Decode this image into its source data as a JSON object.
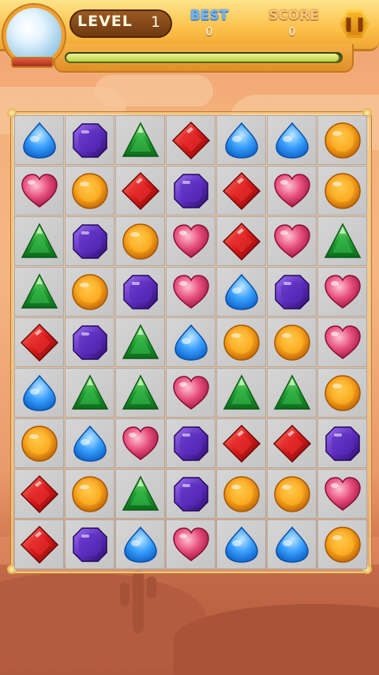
{
  "hud": {
    "level_label": "LEVEL",
    "level_value": "1",
    "best_label": "BEST",
    "best_value": "0",
    "score_label": "SCORE",
    "score_value": "0",
    "progress_fraction": 0.99
  },
  "colors": {
    "blue": "#3aa0ff",
    "purple": "#5a2ab8",
    "green": "#22a034",
    "red": "#d81a1a",
    "pink": "#e8507e",
    "orange": "#f7a21c"
  },
  "board": {
    "rows": [
      [
        "blue-drop-icon",
        "purple-octagon-icon",
        "green-triangle-icon",
        "red-diamond-icon",
        "blue-drop-icon",
        "blue-drop-icon",
        "orange-circle-icon"
      ],
      [
        "pink-heart-icon",
        "orange-circle-icon",
        "red-diamond-icon",
        "purple-octagon-icon",
        "red-diamond-icon",
        "pink-heart-icon",
        "orange-circle-icon"
      ],
      [
        "green-triangle-icon",
        "purple-octagon-icon",
        "orange-circle-icon",
        "pink-heart-icon",
        "red-diamond-icon",
        "pink-heart-icon",
        "green-triangle-icon"
      ],
      [
        "green-triangle-icon",
        "orange-circle-icon",
        "purple-octagon-icon",
        "pink-heart-icon",
        "blue-drop-icon",
        "purple-octagon-icon",
        "pink-heart-icon"
      ],
      [
        "red-diamond-icon",
        "purple-octagon-icon",
        "green-triangle-icon",
        "blue-drop-icon",
        "orange-circle-icon",
        "orange-circle-icon",
        "pink-heart-icon"
      ],
      [
        "blue-drop-icon",
        "green-triangle-icon",
        "green-triangle-icon",
        "pink-heart-icon",
        "green-triangle-icon",
        "green-triangle-icon",
        "orange-circle-icon"
      ],
      [
        "orange-circle-icon",
        "blue-drop-icon",
        "pink-heart-icon",
        "purple-octagon-icon",
        "red-diamond-icon",
        "red-diamond-icon",
        "purple-octagon-icon"
      ],
      [
        "red-diamond-icon",
        "orange-circle-icon",
        "green-triangle-icon",
        "purple-octagon-icon",
        "orange-circle-icon",
        "orange-circle-icon",
        "pink-heart-icon"
      ],
      [
        "red-diamond-icon",
        "purple-octagon-icon",
        "blue-drop-icon",
        "pink-heart-icon",
        "blue-drop-icon",
        "blue-drop-icon",
        "orange-circle-icon"
      ]
    ]
  }
}
